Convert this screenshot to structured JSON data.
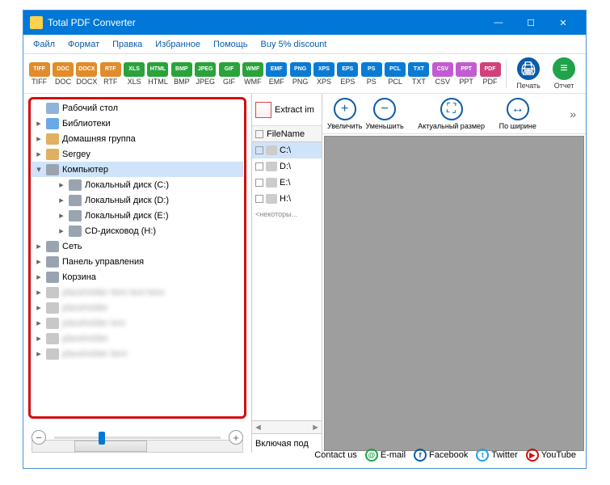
{
  "window": {
    "title": "Total PDF Converter"
  },
  "menu": {
    "file": "Файл",
    "format": "Формат",
    "edit": "Правка",
    "favorites": "Избранное",
    "help": "Помощь",
    "discount": "Buy 5% discount"
  },
  "formats": [
    {
      "label": "TIFF",
      "color": "#e28b2a"
    },
    {
      "label": "DOC",
      "color": "#e28b2a"
    },
    {
      "label": "DOCX",
      "color": "#e28b2a"
    },
    {
      "label": "RTF",
      "color": "#e28b2a"
    },
    {
      "label": "XLS",
      "color": "#2aa33a"
    },
    {
      "label": "HTML",
      "color": "#2aa33a"
    },
    {
      "label": "BMP",
      "color": "#2aa33a"
    },
    {
      "label": "JPEG",
      "color": "#2aa33a"
    },
    {
      "label": "GIF",
      "color": "#2aa33a"
    },
    {
      "label": "WMF",
      "color": "#2aa33a"
    },
    {
      "label": "EMF",
      "color": "#0a7bd4"
    },
    {
      "label": "PNG",
      "color": "#0a7bd4"
    },
    {
      "label": "XPS",
      "color": "#0a7bd4"
    },
    {
      "label": "EPS",
      "color": "#0a7bd4"
    },
    {
      "label": "PS",
      "color": "#0a7bd4"
    },
    {
      "label": "PCL",
      "color": "#0a7bd4"
    },
    {
      "label": "TXT",
      "color": "#0a7bd4"
    },
    {
      "label": "CSV",
      "color": "#c25bd1"
    },
    {
      "label": "PPT",
      "color": "#c25bd1"
    },
    {
      "label": "PDF",
      "color": "#d1417a"
    }
  ],
  "right_buttons": {
    "print": "Печать",
    "report": "Отчет"
  },
  "tree": {
    "root": "Рабочий стол",
    "items": [
      {
        "label": "Библиотеки",
        "icon": "#6aa8e8"
      },
      {
        "label": "Домашняя группа",
        "icon": "#e0b060"
      },
      {
        "label": "Sergey",
        "icon": "#e0b060"
      },
      {
        "label": "Компьютер",
        "icon": "#9aa4b0",
        "sel": true,
        "expanded": true
      },
      {
        "label": "Локальный диск (C:)",
        "icon": "#9aa4b0",
        "sub": true
      },
      {
        "label": "Локальный диск (D:)",
        "icon": "#9aa4b0",
        "sub": true
      },
      {
        "label": "Локальный диск (E:)",
        "icon": "#9aa4b0",
        "sub": true
      },
      {
        "label": "CD-дисковод (H:)",
        "icon": "#9aa4b0",
        "sub": true
      },
      {
        "label": "Сеть",
        "icon": "#9aa4b0"
      },
      {
        "label": "Панель управления",
        "icon": "#9aa4b0"
      },
      {
        "label": "Корзина",
        "icon": "#9aa4b0"
      },
      {
        "label": "placeholder item text here",
        "icon": "#c8c8c8",
        "blur": true
      },
      {
        "label": "placeholder",
        "icon": "#c8c8c8",
        "blur": true
      },
      {
        "label": "placeholder text",
        "icon": "#c8c8c8",
        "blur": true
      },
      {
        "label": "placeholder",
        "icon": "#c8c8c8",
        "blur": true
      },
      {
        "label": "placeholder item",
        "icon": "#c8c8c8",
        "blur": true
      }
    ]
  },
  "mid": {
    "extract": "Extract im",
    "filehead": "FileName",
    "rows": [
      {
        "label": "C:\\",
        "sel": true
      },
      {
        "label": "D:\\"
      },
      {
        "label": "E:\\"
      },
      {
        "label": "H:\\"
      }
    ],
    "partial": "<некоторы...",
    "bottom": "Включая под"
  },
  "view": {
    "zoom_in": "Увеличить",
    "zoom_out": "Уменьшить",
    "actual": "Актуальный размер",
    "width": "По ширине"
  },
  "footer": {
    "contact": "Contact us",
    "email": "E-mail",
    "fb": "Facebook",
    "tw": "Twitter",
    "yt": "YouTube"
  }
}
